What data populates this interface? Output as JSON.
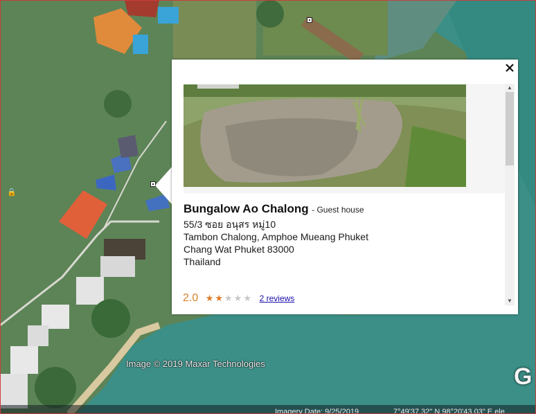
{
  "map": {
    "copyright": "Image © 2019 Maxar Technologies",
    "imagery_date": "Imagery Date: 9/25/2019",
    "coordinates": "7°49'37.32\" N   98°20'43.03\" E   ele",
    "logo_letter": "G"
  },
  "balloon": {
    "place_name": "Bungalow Ao Chalong",
    "category": "- Guest house",
    "address": [
      "55/3 ซอย อนุสร หมู่10",
      "Tambon Chalong, Amphoe Mueang Phuket",
      "Chang Wat Phuket 83000",
      "Thailand"
    ],
    "rating": "2.0",
    "rating_value": 2,
    "rating_max": 5,
    "reviews_link": "2 reviews",
    "close_icon": "close-icon",
    "accent_color": "#e07b28"
  }
}
